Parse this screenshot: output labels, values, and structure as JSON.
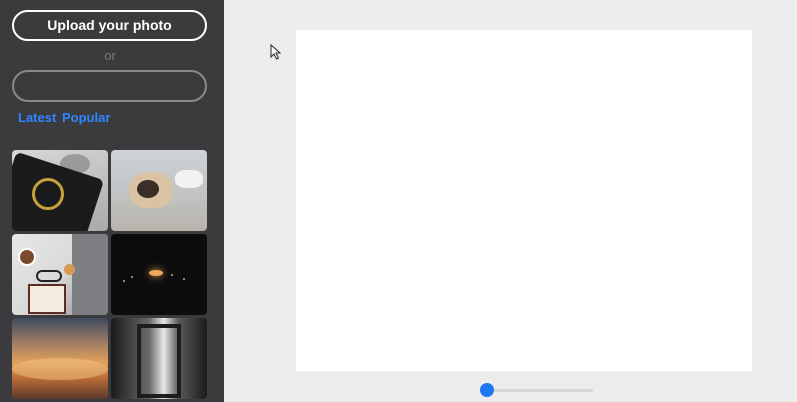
{
  "sidebar": {
    "upload_label": "Upload your photo",
    "or_label": "or",
    "search": {
      "value": "",
      "placeholder": ""
    },
    "tabs": [
      {
        "label": "Latest"
      },
      {
        "label": "Popular"
      }
    ],
    "photos": [
      {
        "icon": "notebook-photo"
      },
      {
        "icon": "pug-photo"
      },
      {
        "icon": "desk-flatlay-photo"
      },
      {
        "icon": "night-city-photo"
      },
      {
        "icon": "sunset-clouds-photo"
      },
      {
        "icon": "light-rays-photo"
      }
    ]
  },
  "main": {
    "zoom": {
      "value": 0
    }
  },
  "colors": {
    "sidebar_bg": "#3b3b3d",
    "accent": "#2f86ff",
    "slider": "#1f78f2",
    "workspace_bg": "#ececec",
    "canvas_bg": "#ffffff"
  }
}
